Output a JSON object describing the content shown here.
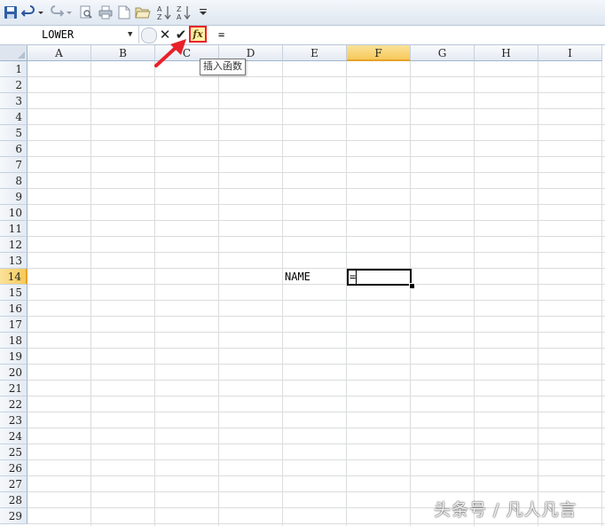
{
  "qat": {
    "icons": [
      "save-icon",
      "undo-icon",
      "redo-icon",
      "print-preview-icon",
      "print-icon",
      "new-icon",
      "open-icon",
      "sort-ascending-icon",
      "sort-descending-icon",
      "customize-icon"
    ]
  },
  "formula_bar": {
    "name_box": "LOWER",
    "fx_label": "fx",
    "formula": "="
  },
  "tooltip": "插入函数",
  "columns": [
    "A",
    "B",
    "C",
    "D",
    "E",
    "F",
    "G",
    "H",
    "I"
  ],
  "selected_column": "F",
  "rows": [
    "1",
    "2",
    "3",
    "4",
    "5",
    "6",
    "7",
    "8",
    "9",
    "10",
    "11",
    "12",
    "13",
    "14",
    "15",
    "16",
    "17",
    "18",
    "19",
    "20",
    "21",
    "22",
    "23",
    "24",
    "25",
    "26",
    "27",
    "28",
    "29"
  ],
  "selected_row": "14",
  "cells": {
    "E14": "NAME",
    "F14": "="
  },
  "watermark": "头条号 / 凡人凡言",
  "colors": {
    "highlight_red": "#e8202a",
    "header_selected": "#f6c95a"
  }
}
